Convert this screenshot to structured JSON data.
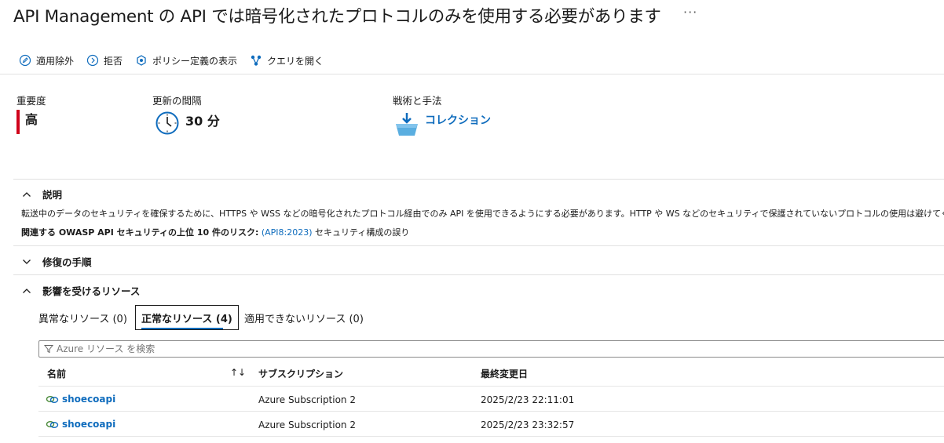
{
  "title": "API Management の API では暗号化されたプロトコルのみを使用する必要があります",
  "more_label": "···",
  "toolbar": {
    "exempt": "適用除外",
    "deny": "拒否",
    "view_policy": "ポリシー定義の表示",
    "open_query": "クエリを開く"
  },
  "severity": {
    "label": "重要度",
    "value": "高",
    "color": "#d0021b"
  },
  "freshness": {
    "label": "更新の間隔",
    "value": "30 分"
  },
  "tactics": {
    "label": "戦術と手法",
    "value": "コレクション"
  },
  "description": {
    "header": "説明",
    "text": "転送中のデータのセキュリティを確保するために、HTTPS や WSS などの暗号化されたプロトコル経由でのみ API を使用できるようにする必要があります。HTTP や WS などのセキュリティで保護されていないプロトコルの使用は避けてください。",
    "owasp_prefix": "関連する OWASP API セキュリティの上位 10 件のリスク:",
    "owasp_link": "(API8:2023)",
    "owasp_suffix": "セキュリティ構成の誤り"
  },
  "remediation": {
    "header": "修復の手順"
  },
  "affected": {
    "header": "影響を受けるリソース",
    "tabs": [
      {
        "label": "異常なリソース (0)"
      },
      {
        "label": "正常なリソース (4)"
      },
      {
        "label": "適用できないリソース (0)"
      }
    ],
    "search_placeholder": "Azure リソース を検索",
    "columns": {
      "name": "名前",
      "subscription": "サブスクリプション",
      "modified": "最終変更日"
    },
    "sort_icon": "↑↓",
    "rows": [
      {
        "name": "shoecoapi",
        "subscription": "Azure Subscription 2",
        "modified": "2025/2/23 22:11:01"
      },
      {
        "name": "shoecoapi",
        "subscription": "Azure Subscription 2",
        "modified": "2025/2/23 23:32:57"
      }
    ]
  },
  "colors": {
    "accent": "#0f6cbd",
    "severity_high": "#d0021b"
  }
}
